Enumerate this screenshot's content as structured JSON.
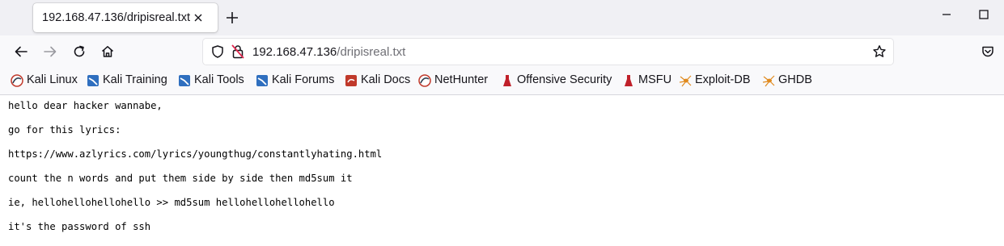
{
  "tab": {
    "title": "192.168.47.136/dripisreal.txt"
  },
  "address_bar": {
    "host": "192.168.47.136",
    "path": "/dripisreal.txt"
  },
  "bookmarks": [
    {
      "label": "Kali Linux",
      "icon": "kali-dragon-icon"
    },
    {
      "label": "Kali Training",
      "icon": "kali-training-icon"
    },
    {
      "label": "Kali Tools",
      "icon": "kali-tools-icon"
    },
    {
      "label": "Kali Forums",
      "icon": "kali-forums-icon"
    },
    {
      "label": "Kali Docs",
      "icon": "kali-docs-icon"
    },
    {
      "label": "NetHunter",
      "icon": "nethunter-icon"
    },
    {
      "label": "Offensive Security",
      "icon": "offsec-icon"
    },
    {
      "label": "MSFU",
      "icon": "msfu-icon"
    },
    {
      "label": "Exploit-DB",
      "icon": "exploit-db-icon"
    },
    {
      "label": "GHDB",
      "icon": "ghdb-icon"
    }
  ],
  "document": {
    "lines": [
      "hello dear hacker wannabe,",
      "go for this lyrics:",
      "https://www.azlyrics.com/lyrics/youngthug/constantlyhating.html",
      "count the n words and put them side by side then md5sum it",
      "ie, hellohellohellohello >> md5sum hellohellohellohello",
      "it's the password of ssh"
    ]
  }
}
